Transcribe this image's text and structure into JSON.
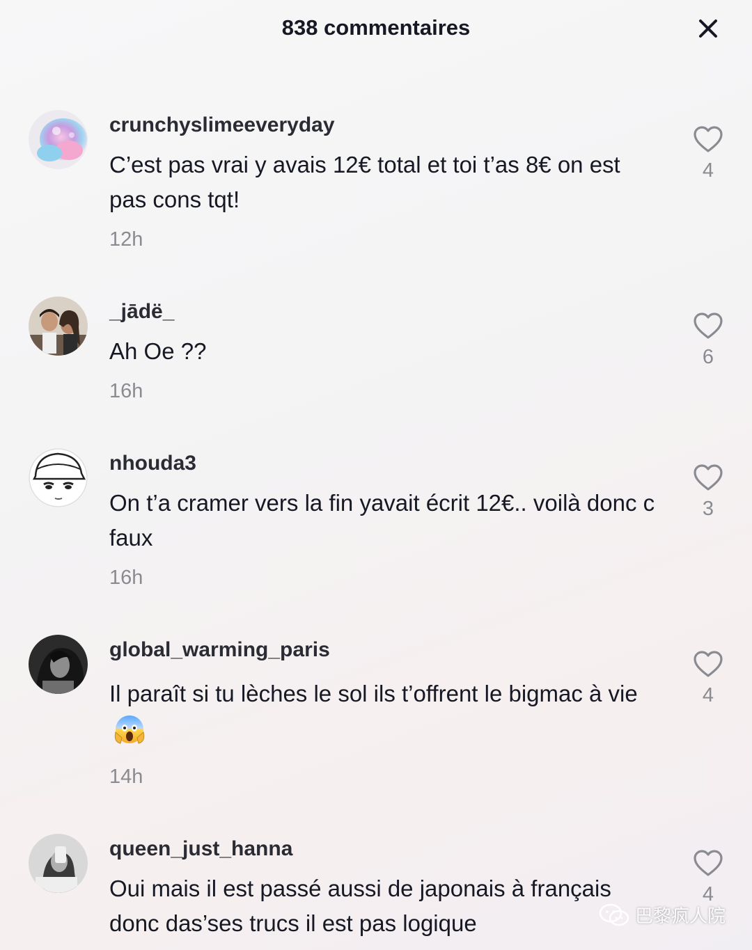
{
  "header": {
    "title": "838 commentaires",
    "close_icon": "close-icon"
  },
  "comments": [
    {
      "username": "crunchyslimeeveryday",
      "text": "C’est pas vrai y avais 12€ total et toi t’as 8€ on est pas cons tqt!",
      "time": "12h",
      "likes": "4",
      "avatar": "pink-blue-slime"
    },
    {
      "username": "_jādë_",
      "text": "Ah Oe ??",
      "time": "16h",
      "likes": "6",
      "avatar": "two-people-photo"
    },
    {
      "username": "nhouda3",
      "text": "On t’a cramer vers la fin yavait écrit 12€.. voilà donc c faux",
      "time": "16h",
      "likes": "3",
      "avatar": "girl-with-cap-drawing"
    },
    {
      "username": "global_warming_paris",
      "text": "Il paraît si tu lèches le sol ils t’offrent le bigmac à vie",
      "emoji": "screaming-face-emoji",
      "time": "14h",
      "likes": "4",
      "avatar": "dark-portrait"
    },
    {
      "username": "queen_just_hanna",
      "text": "Oui mais il est passé aussi de japonais à français donc das’ses trucs il est pas logique",
      "likes": "4",
      "avatar": "mirror-selfie"
    }
  ],
  "icons": {
    "like": "heart-outline-icon",
    "watermark": "wechat-icon"
  },
  "watermark": {
    "text": "巴黎疯人院"
  },
  "colors": {
    "text": "#161823",
    "secondary": "#8a8b91"
  }
}
